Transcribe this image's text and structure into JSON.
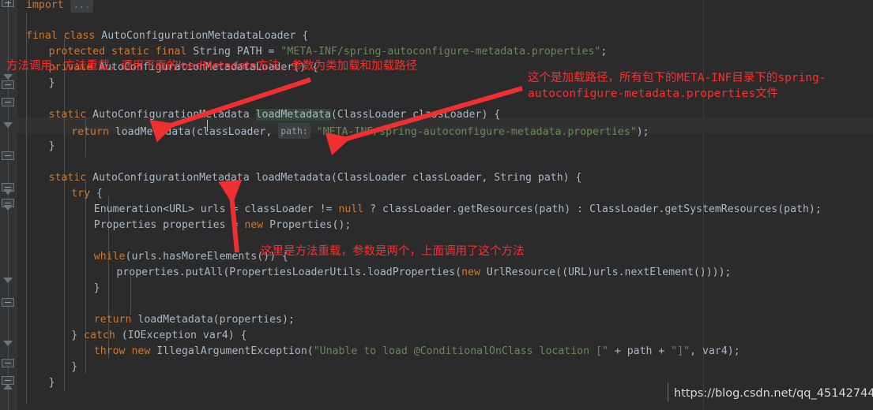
{
  "editor": {
    "theme_bg": "#2b2b2b",
    "gutter_bg": "#313335",
    "highlight_line_bg": "#323232",
    "code_lines": [
      {
        "indent": 0,
        "segments": [
          {
            "t": "import ",
            "c": "kw"
          }
        ],
        "fold_ellipsis": "..."
      },
      {
        "indent": 0,
        "segments": []
      },
      {
        "indent": 0,
        "segments": [
          {
            "t": "final",
            "c": "kw"
          },
          {
            "t": " ",
            "c": "punct"
          },
          {
            "t": "class",
            "c": "kw"
          },
          {
            "t": " AutoConfigurationMetadataLoader {",
            "c": "cls"
          }
        ]
      },
      {
        "indent": 1,
        "segments": [
          {
            "t": "protected",
            "c": "kw"
          },
          {
            "t": " ",
            "c": "punct"
          },
          {
            "t": "static",
            "c": "kw"
          },
          {
            "t": " ",
            "c": "punct"
          },
          {
            "t": "final",
            "c": "kw"
          },
          {
            "t": " String PATH = ",
            "c": "ident"
          },
          {
            "t": "\"META-INF/spring-autoconfigure-metadata.properties\"",
            "c": "str"
          },
          {
            "t": ";",
            "c": "punct"
          }
        ]
      },
      {
        "indent": 1,
        "segments": [
          {
            "t": "private",
            "c": "kw"
          },
          {
            "t": " AutoConfigurationMetadataLoader() {",
            "c": "ident"
          }
        ]
      },
      {
        "indent": 1,
        "segments": [
          {
            "t": "}",
            "c": "punct"
          }
        ]
      },
      {
        "indent": 0,
        "segments": []
      },
      {
        "indent": 1,
        "segments": [
          {
            "t": "static",
            "c": "kw"
          },
          {
            "t": " AutoConfigurationMetadata ",
            "c": "ident"
          },
          {
            "t": "loadMetadata",
            "c": "ident-hl"
          },
          {
            "t": "(ClassLoader classLoader) {",
            "c": "ident"
          }
        ],
        "highlight": true
      },
      {
        "indent": 2,
        "segments": [
          {
            "t": "return",
            "c": "kw"
          },
          {
            "t": " loadMetadata(classLoader, ",
            "c": "ident"
          },
          {
            "t": "path:",
            "c": "hint"
          },
          {
            "t": " ",
            "c": "ident"
          },
          {
            "t": "\"META-INF/spring-autoconfigure-metadata.properties\"",
            "c": "str"
          },
          {
            "t": ");",
            "c": "punct"
          }
        ]
      },
      {
        "indent": 1,
        "segments": [
          {
            "t": "}",
            "c": "punct"
          }
        ]
      },
      {
        "indent": 0,
        "segments": []
      },
      {
        "indent": 1,
        "segments": [
          {
            "t": "static",
            "c": "kw"
          },
          {
            "t": " AutoConfigurationMetadata loadMetadata(ClassLoader classLoader, String path) {",
            "c": "ident"
          }
        ]
      },
      {
        "indent": 2,
        "segments": [
          {
            "t": "try",
            "c": "kw"
          },
          {
            "t": " {",
            "c": "punct"
          }
        ]
      },
      {
        "indent": 3,
        "segments": [
          {
            "t": "Enumeration<URL> urls = classLoader != ",
            "c": "ident"
          },
          {
            "t": "null",
            "c": "kw"
          },
          {
            "t": " ? classLoader.getResources(path) : ClassLoader.getSystemResources(path);",
            "c": "ident"
          }
        ]
      },
      {
        "indent": 3,
        "segments": [
          {
            "t": "Properties properties = ",
            "c": "ident"
          },
          {
            "t": "new",
            "c": "kw"
          },
          {
            "t": " Properties();",
            "c": "ident"
          }
        ]
      },
      {
        "indent": 0,
        "segments": []
      },
      {
        "indent": 3,
        "segments": [
          {
            "t": "while",
            "c": "kw"
          },
          {
            "t": "(urls.hasMoreElements()) {",
            "c": "ident"
          }
        ]
      },
      {
        "indent": 4,
        "segments": [
          {
            "t": "properties.putAll(PropertiesLoaderUtils.loadProperties(",
            "c": "ident"
          },
          {
            "t": "new",
            "c": "kw"
          },
          {
            "t": " UrlResource((URL)urls.nextElement())));",
            "c": "ident"
          }
        ]
      },
      {
        "indent": 3,
        "segments": [
          {
            "t": "}",
            "c": "punct"
          }
        ]
      },
      {
        "indent": 0,
        "segments": []
      },
      {
        "indent": 3,
        "segments": [
          {
            "t": "return",
            "c": "kw"
          },
          {
            "t": " loadMetadata(properties);",
            "c": "ident"
          }
        ]
      },
      {
        "indent": 2,
        "segments": [
          {
            "t": "} ",
            "c": "punct"
          },
          {
            "t": "catch",
            "c": "kw"
          },
          {
            "t": " (IOException var4) {",
            "c": "ident"
          }
        ]
      },
      {
        "indent": 3,
        "segments": [
          {
            "t": "throw",
            "c": "kw"
          },
          {
            "t": " ",
            "c": "punct"
          },
          {
            "t": "new",
            "c": "kw"
          },
          {
            "t": " IllegalArgumentException(",
            "c": "ident"
          },
          {
            "t": "\"Unable to load @ConditionalOnClass location [\"",
            "c": "str"
          },
          {
            "t": " + path + ",
            "c": "ident"
          },
          {
            "t": "\"]\"",
            "c": "str"
          },
          {
            "t": ", var4);",
            "c": "ident"
          }
        ]
      },
      {
        "indent": 2,
        "segments": [
          {
            "t": "}",
            "c": "punct"
          }
        ]
      },
      {
        "indent": 1,
        "segments": [
          {
            "t": "}",
            "c": "punct"
          }
        ]
      }
    ]
  },
  "annotations": [
    {
      "id": "anno-method-call",
      "text": "方法调用，方法重载，调用下面的loadMetadata方法，参数为类加载和加载路径"
    },
    {
      "id": "anno-load-path-line1",
      "text": "这个是加载路径，所有包下的META-INF目录下的spring-"
    },
    {
      "id": "anno-load-path-line2",
      "text": "autoconfigure-metadata.properties文件"
    },
    {
      "id": "anno-overload",
      "text": "这里是方法重载，参数是两个，上面调用了这个方法"
    }
  ],
  "annotation_color": "#ff2d2d",
  "watermark": {
    "text": "https://blog.csdn.net/qq_45142744"
  }
}
